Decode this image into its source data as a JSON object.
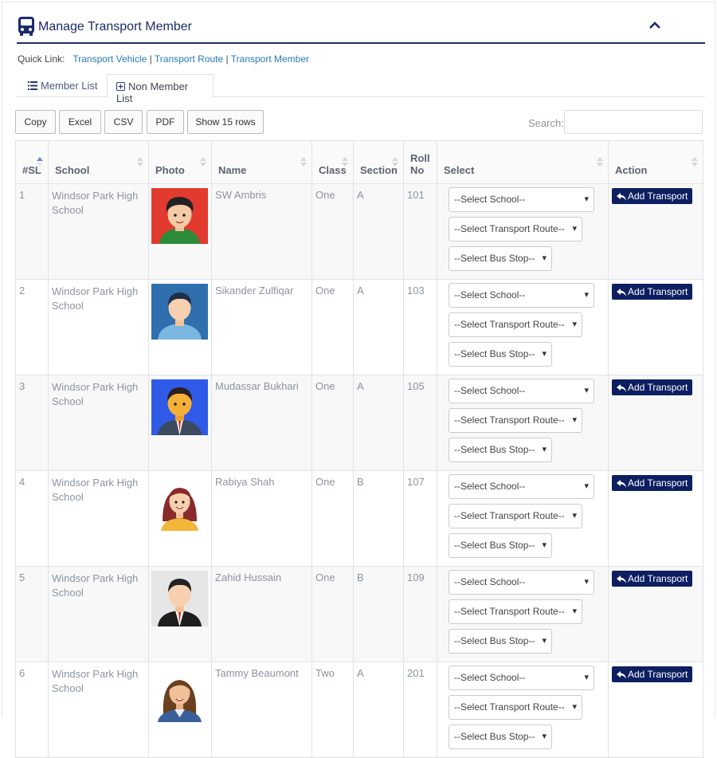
{
  "header": {
    "title": "Manage Transport Member"
  },
  "quick_links": {
    "label": "Quick Link:",
    "links": [
      "Transport Vehicle",
      "Transport Route",
      "Transport Member"
    ],
    "separator": "|"
  },
  "tabs": [
    {
      "label": "Member List"
    },
    {
      "label": "Non Member List"
    }
  ],
  "toolbar": {
    "buttons": [
      "Copy",
      "Excel",
      "CSV",
      "PDF",
      "Show 15 rows"
    ],
    "search_label": "Search:"
  },
  "table": {
    "columns": [
      "#SL",
      "School",
      "Photo",
      "Name",
      "Class",
      "Section",
      "Roll No",
      "Select",
      "Action"
    ],
    "select_school": "--Select School--",
    "select_route": "--Select Transport Route--",
    "select_stop": "--Select Bus Stop--",
    "action_label": "Add Transport",
    "rows": [
      {
        "sl": "1",
        "school": "Windsor Park High School",
        "name": "SW Ambris",
        "class": "One",
        "section": "A",
        "roll": "101"
      },
      {
        "sl": "2",
        "school": "Windsor Park High School",
        "name": "Sikander Zulfiqar",
        "class": "One",
        "section": "A",
        "roll": "103"
      },
      {
        "sl": "3",
        "school": "Windsor Park High School",
        "name": "Mudassar Bukhari",
        "class": "One",
        "section": "A",
        "roll": "105"
      },
      {
        "sl": "4",
        "school": "Windsor Park High School",
        "name": "Rabiya Shah",
        "class": "One",
        "section": "B",
        "roll": "107"
      },
      {
        "sl": "5",
        "school": "Windsor Park High School",
        "name": "Zahid Hussain",
        "class": "One",
        "section": "B",
        "roll": "109"
      },
      {
        "sl": "6",
        "school": "Windsor Park High School",
        "name": "Tammy Beaumont",
        "class": "Two",
        "section": "A",
        "roll": "201"
      }
    ]
  },
  "colors": {
    "accent": "#1d2b6b",
    "action_button": "#0d1f61",
    "link": "#2a7ab8"
  }
}
